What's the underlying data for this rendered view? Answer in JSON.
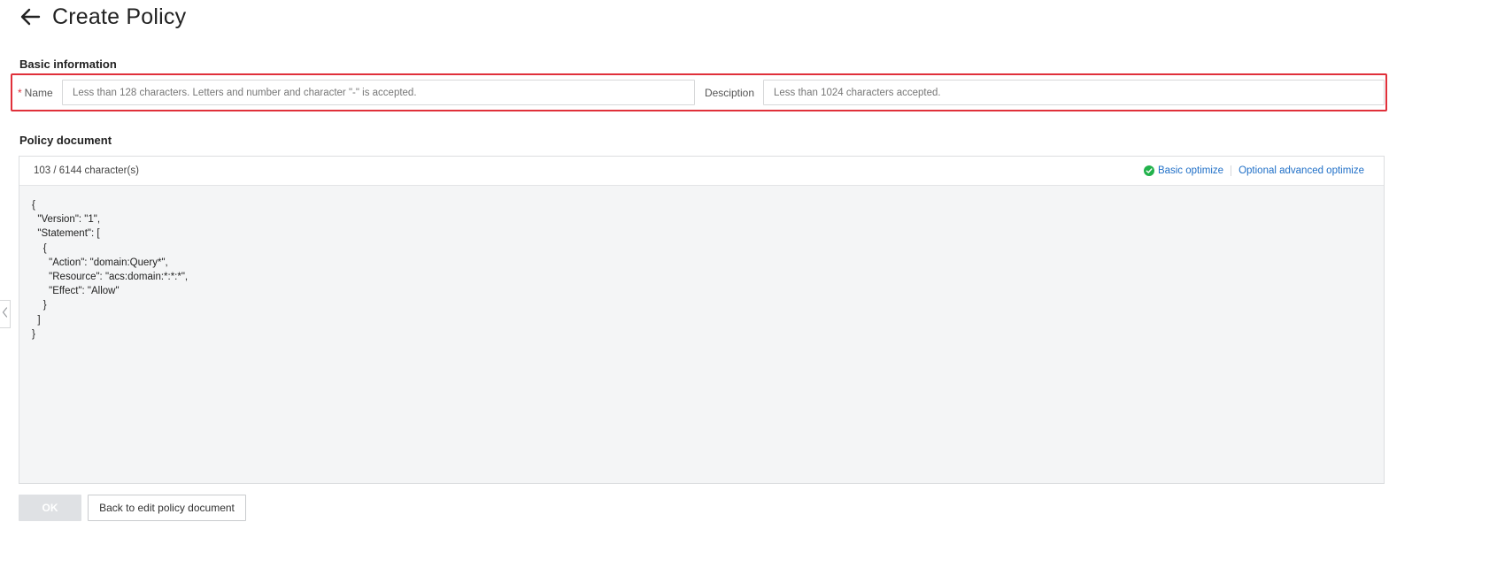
{
  "header": {
    "title": "Create Policy",
    "back_icon": "arrow-left-icon"
  },
  "basic_info": {
    "section_title": "Basic information",
    "name": {
      "required_mark": "*",
      "label": "Name",
      "value": "",
      "placeholder": "Less than 128 characters. Letters and number and character \"-\" is accepted."
    },
    "description": {
      "label": "Desciption",
      "value": "",
      "placeholder": "Less than 1024 characters accepted."
    },
    "highlight_color": "#e0303a"
  },
  "policy_document": {
    "section_title": "Policy document",
    "char_count": "103 / 6144 character(s)",
    "basic_optimize": {
      "label": "Basic optimize",
      "icon": "check-circle-icon",
      "icon_color": "#22b24c"
    },
    "advanced_optimize": {
      "label": "Optional advanced optimize"
    },
    "link_color": "#1f6fc7",
    "content": "{\n  \"Version\": \"1\",\n  \"Statement\": [\n    {\n      \"Action\": \"domain:Query*\",\n      \"Resource\": \"acs:domain:*:*:*\",\n      \"Effect\": \"Allow\"\n    }\n  ]\n}"
  },
  "sidebar_toggle": {
    "icon": "chevron-left-icon"
  },
  "actions": {
    "ok_label": "OK",
    "back_label": "Back to edit policy document"
  }
}
